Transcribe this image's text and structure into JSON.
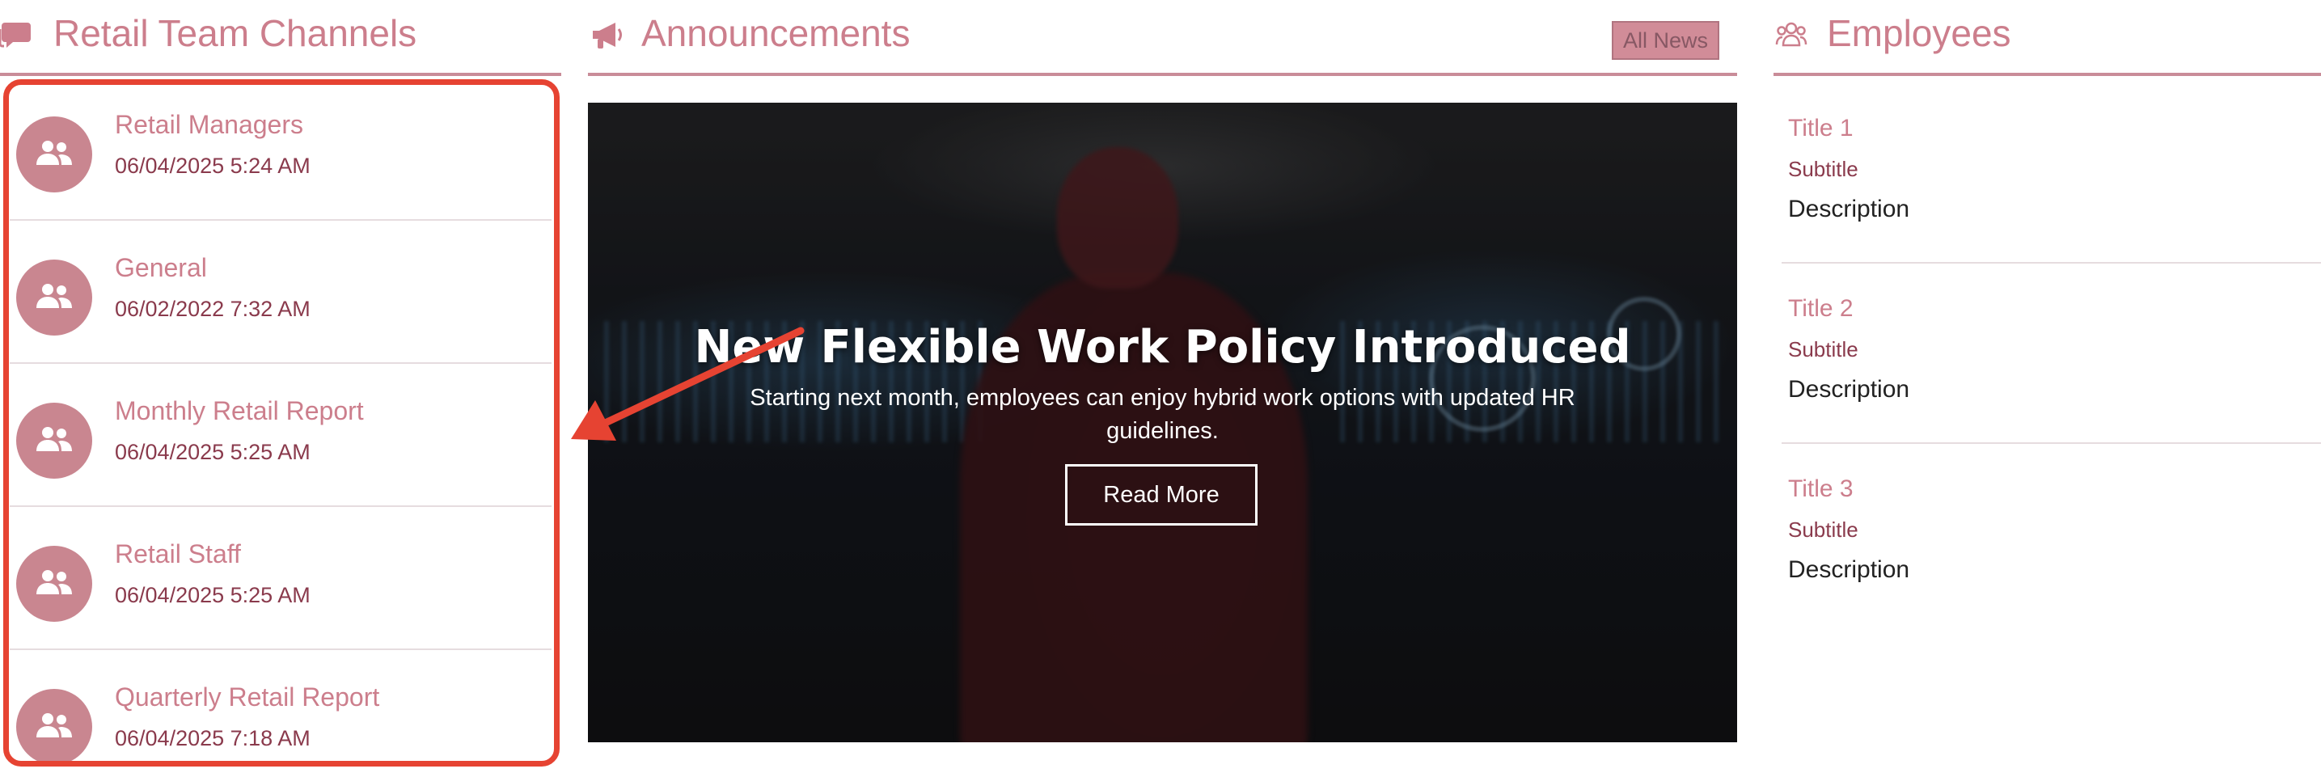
{
  "channels": {
    "header_icon": "chat-icon",
    "title": "Retail Team Channels",
    "items": [
      {
        "name": "Retail Managers",
        "date": "06/04/2025 5:24 AM",
        "icon": "people-icon"
      },
      {
        "name": "General",
        "date": "06/02/2022 7:32 AM",
        "icon": "people-icon"
      },
      {
        "name": "Monthly Retail Report",
        "date": "06/04/2025 5:25 AM",
        "icon": "people-icon"
      },
      {
        "name": "Retail Staff",
        "date": "06/04/2025 5:25 AM",
        "icon": "people-icon"
      },
      {
        "name": "Quarterly Retail Report",
        "date": "06/04/2025 7:18 AM",
        "icon": "people-icon"
      }
    ]
  },
  "announcements": {
    "header_icon": "megaphone-icon",
    "title": "Announcements",
    "all_news_label": "All News",
    "hero": {
      "title": "New Flexible Work Policy Introduced",
      "description": "Starting next month, employees can enjoy hybrid work options with updated HR guidelines.",
      "button_label": "Read More"
    }
  },
  "employees": {
    "header_icon": "group-icon",
    "title": "Employees",
    "items": [
      {
        "title": "Title 1",
        "subtitle": "Subtitle",
        "description": "Description"
      },
      {
        "title": "Title 2",
        "subtitle": "Subtitle",
        "description": "Description"
      },
      {
        "title": "Title 3",
        "subtitle": "Subtitle",
        "description": "Description"
      }
    ]
  },
  "colors": {
    "accent": "#cc7e8c",
    "accent_dark": "#8a3a4c",
    "avatar": "#c98690",
    "highlight": "#e64332"
  }
}
